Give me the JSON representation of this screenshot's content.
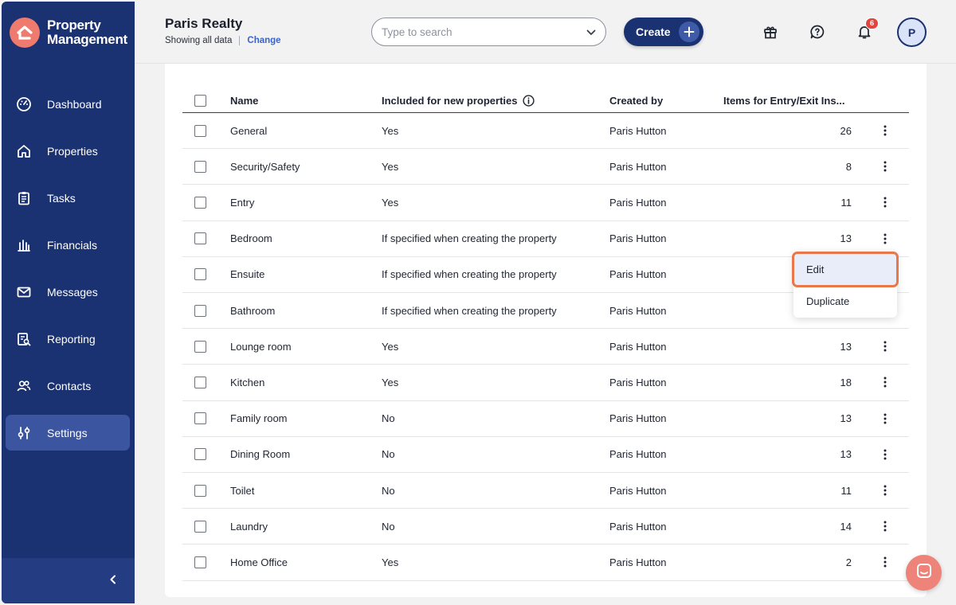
{
  "brand": {
    "line1": "Property",
    "line2": "Management",
    "logo_icon": "house-logo-icon"
  },
  "nav": [
    {
      "label": "Dashboard",
      "icon": "dashboard-icon"
    },
    {
      "label": "Properties",
      "icon": "house-icon"
    },
    {
      "label": "Tasks",
      "icon": "clipboard-icon"
    },
    {
      "label": "Financials",
      "icon": "bank-icon"
    },
    {
      "label": "Messages",
      "icon": "envelope-icon"
    },
    {
      "label": "Reporting",
      "icon": "report-search-icon"
    },
    {
      "label": "Contacts",
      "icon": "people-icon"
    },
    {
      "label": "Settings",
      "icon": "sliders-icon",
      "active": true
    }
  ],
  "header": {
    "org_title": "Paris Realty",
    "scope_text": "Showing all data",
    "change_link": "Change",
    "search_placeholder": "Type to search",
    "create_label": "Create",
    "notification_count": "6",
    "avatar_initial": "P"
  },
  "table": {
    "columns": {
      "name": "Name",
      "included": "Included for new properties",
      "created_by": "Created by",
      "items": "Items for Entry/Exit Ins..."
    },
    "rows": [
      {
        "name": "General",
        "included": "Yes",
        "created_by": "Paris Hutton",
        "items": "26"
      },
      {
        "name": "Security/Safety",
        "included": "Yes",
        "created_by": "Paris Hutton",
        "items": "8"
      },
      {
        "name": "Entry",
        "included": "Yes",
        "created_by": "Paris Hutton",
        "items": "11"
      },
      {
        "name": "Bedroom",
        "included": "If specified when creating the property",
        "created_by": "Paris Hutton",
        "items": "13"
      },
      {
        "name": "Ensuite",
        "included": "If specified when creating the property",
        "created_by": "Paris Hutton",
        "items": ""
      },
      {
        "name": "Bathroom",
        "included": "If specified when creating the property",
        "created_by": "Paris Hutton",
        "items": ""
      },
      {
        "name": "Lounge room",
        "included": "Yes",
        "created_by": "Paris Hutton",
        "items": "13"
      },
      {
        "name": "Kitchen",
        "included": "Yes",
        "created_by": "Paris Hutton",
        "items": "18"
      },
      {
        "name": "Family room",
        "included": "No",
        "created_by": "Paris Hutton",
        "items": "13"
      },
      {
        "name": "Dining Room",
        "included": "No",
        "created_by": "Paris Hutton",
        "items": "13"
      },
      {
        "name": "Toilet",
        "included": "No",
        "created_by": "Paris Hutton",
        "items": "11"
      },
      {
        "name": "Laundry",
        "included": "No",
        "created_by": "Paris Hutton",
        "items": "14"
      },
      {
        "name": "Home Office",
        "included": "Yes",
        "created_by": "Paris Hutton",
        "items": "2"
      }
    ]
  },
  "menu": {
    "edit": "Edit",
    "duplicate": "Duplicate"
  },
  "colors": {
    "sidebar": "#1b3272",
    "accent": "#3a62c9",
    "brand_coral": "#ef7a6e",
    "highlight": "#e8774b"
  }
}
